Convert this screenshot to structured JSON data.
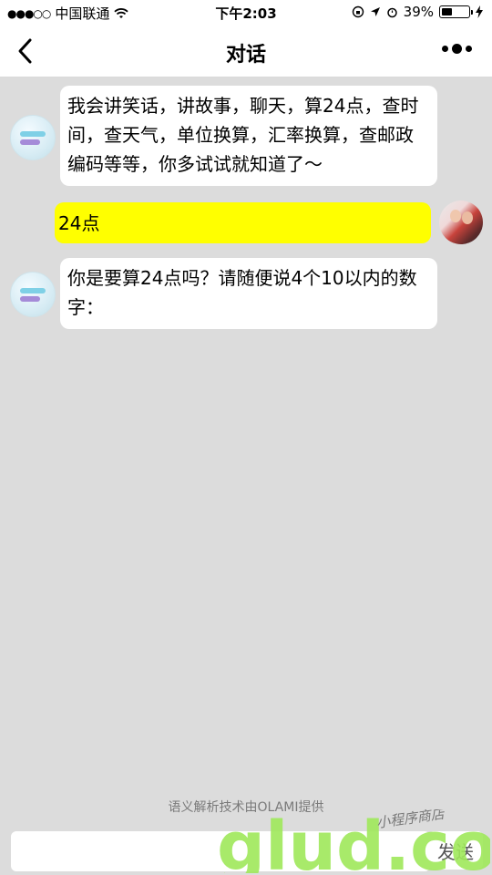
{
  "status_bar": {
    "signal": "●●●○○",
    "carrier": "中国联通",
    "time": "下午2:03",
    "battery_percent": "39%"
  },
  "nav": {
    "title": "对话",
    "back_glyph": "<",
    "more_icon": "more-dots-icon"
  },
  "messages": [
    {
      "sender": "bot",
      "text": "我会讲笑话，讲故事，聊天，算24点，查时间，查天气，单位换算，汇率换算，查邮政编码等等，你多试试就知道了～"
    },
    {
      "sender": "user",
      "text": "24点"
    },
    {
      "sender": "bot",
      "text": "你是要算24点吗？请随便说4个10以内的数字："
    }
  ],
  "footer": {
    "powered_by": "语义解析技术由OLAMI提供",
    "send_label": "发送",
    "input_value": ""
  },
  "watermark": {
    "text": "glud.com",
    "subtext": "小程序商店"
  },
  "colors": {
    "user_bubble": "#ffff00",
    "bot_bubble": "#ffffff",
    "background": "#dcdcdc"
  }
}
